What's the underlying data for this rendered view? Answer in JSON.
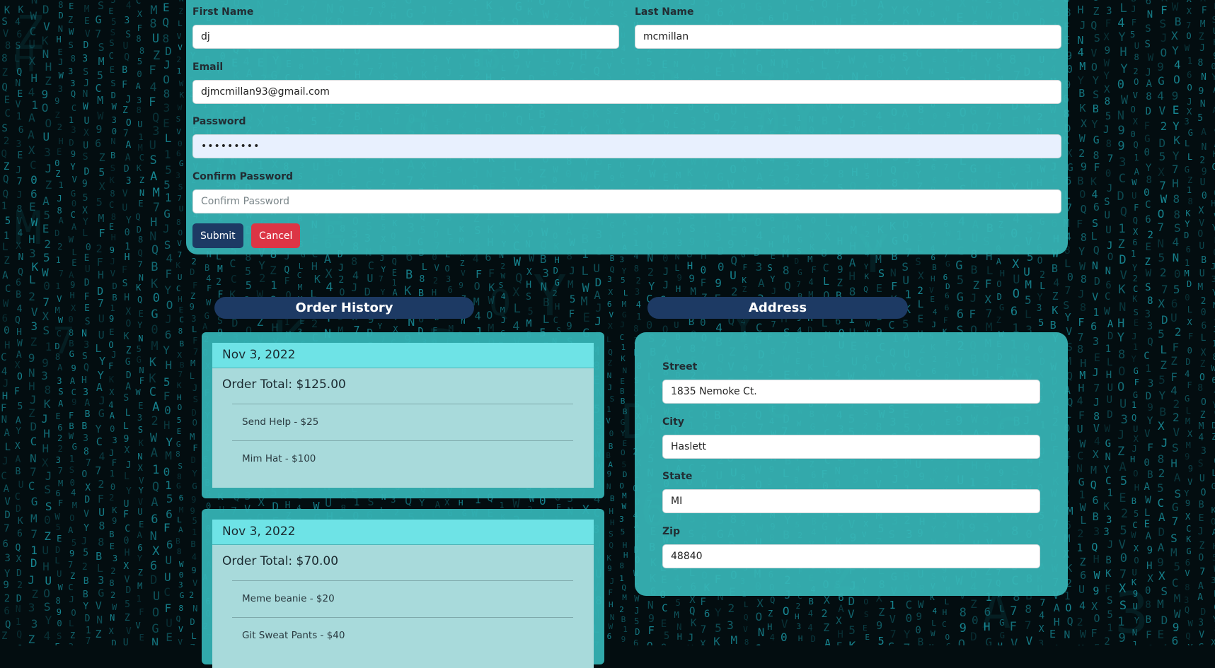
{
  "profile": {
    "first_name": {
      "label": "First Name",
      "value": "dj"
    },
    "last_name": {
      "label": "Last Name",
      "value": "mcmillan"
    },
    "email": {
      "label": "Email",
      "value": "djmcmillan93@gmail.com"
    },
    "password": {
      "label": "Password",
      "value": "•••••••••"
    },
    "confirm_password": {
      "label": "Confirm Password",
      "placeholder": "Confirm Password"
    },
    "submit_label": "Submit",
    "cancel_label": "Cancel"
  },
  "order_history": {
    "title": "Order History",
    "orders": [
      {
        "date": "Nov 3, 2022",
        "total": "Order Total: $125.00",
        "items": [
          "Send Help - $25",
          "Mim Hat - $100"
        ]
      },
      {
        "date": "Nov 3, 2022",
        "total": "Order Total: $70.00",
        "items": [
          "Meme beanie - $20",
          "Git Sweat Pants - $40"
        ]
      }
    ]
  },
  "address": {
    "title": "Address",
    "street": {
      "label": "Street",
      "value": "1835 Nemoke Ct."
    },
    "city": {
      "label": "City",
      "value": "Haslett"
    },
    "state": {
      "label": "State",
      "value": "MI"
    },
    "zip": {
      "label": "Zip",
      "value": "48840"
    }
  },
  "theme": {
    "panel_color": "#37b6b7",
    "pill_color": "#1d3a64",
    "cancel_color": "#dc3545",
    "order_header_color": "#6ee3e6"
  }
}
